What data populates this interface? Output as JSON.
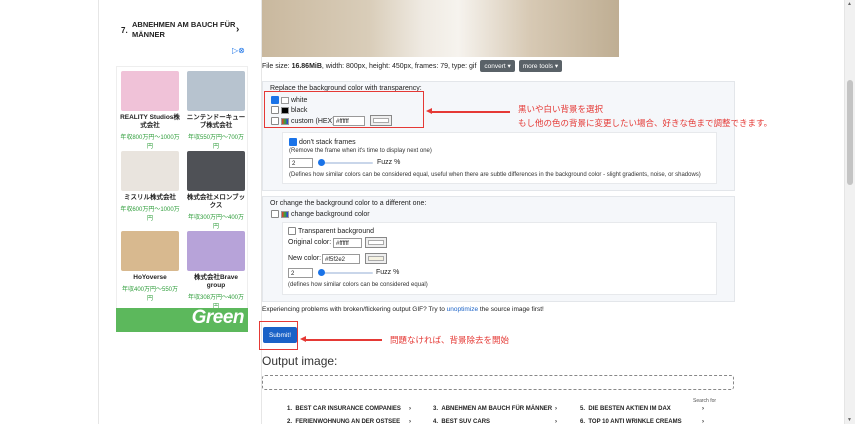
{
  "left_ad": {
    "top_item": {
      "num": "7.",
      "text": "ABNEHMEN AM BAUCH FÜR MÄNNER",
      "chevron": "›"
    },
    "ad_choices": "▷⊗",
    "jobs": [
      {
        "name": "REALITY Studios株式会社",
        "salary": "年収800万円〜1000万円",
        "img_color": "#f0c2d8"
      },
      {
        "name": "ニンテンドーキューブ株式会社",
        "salary": "年収550万円〜700万円",
        "img_color": "#b7c3cf"
      },
      {
        "name": "ミスリル株式会社",
        "salary": "年収600万円〜1000万円",
        "img_color": "#e9e4de"
      },
      {
        "name": "株式会社メロンブックス",
        "salary": "年収300万円〜400万円",
        "img_color": "#4f5156"
      },
      {
        "name": "HoYoverse",
        "salary": "年収400万円〜550万円",
        "img_color": "#d8b98f"
      },
      {
        "name": "株式会社Brave group",
        "salary": "年収308万円〜400万円",
        "img_color": "#b7a3d9"
      }
    ],
    "banner_text": "Green"
  },
  "file_info": {
    "prefix": "File size: ",
    "size": "16.86MiB",
    "rest": ", width: 800px, height: 450px, frames: 79, type: gif",
    "convert_label": "convert ▾",
    "more_tools_label": "more tools ▾"
  },
  "replace_panel": {
    "heading": "Replace the background color with transparency:",
    "white_label": "white",
    "black_label": "black",
    "custom_label": "custom (HEX):",
    "custom_value": "#ffffff",
    "dont_stack_label": "don't stack frames",
    "dont_stack_hint": "(Remove the frame when it's time to display next one)",
    "fuzz_value": "2",
    "fuzz_label": "Fuzz %",
    "fuzz_level_percent": 2,
    "fuzz_hint": "(Defines how similar colors can be considered equal, useful when there are subtle differences in the background color - slight gradients, noise, or shadows)"
  },
  "change_panel": {
    "heading": "Or change the background color to a different one:",
    "change_label": "change background color",
    "transparent_label": "Transparent background",
    "original_label": "Original color:",
    "original_value": "#ffffff",
    "new_label": "New color:",
    "new_value": "#f5f2e2",
    "fuzz_value": "2",
    "fuzz_label": "Fuzz %",
    "fuzz_level_percent": 2,
    "fuzz_hint": "(defines how similar colors can be considered equal)"
  },
  "problem_note": {
    "before": "Experiencing problems with broken/flickering output GIF? Try to ",
    "link": "unoptimize",
    "after": " the source image first!"
  },
  "submit_label": "Submit!",
  "output_title": "Output image:",
  "search_for": "Search for",
  "bottom_ads": [
    {
      "num": "1.",
      "text": "BEST CAR INSURANCE COMPANIES",
      "chevron": "›"
    },
    {
      "num": "3.",
      "text": "ABNEHMEN AM BAUCH FÜR MÄNNER",
      "chevron": "›"
    },
    {
      "num": "5.",
      "text": "DIE BESTEN AKTIEN IM DAX",
      "chevron": "›"
    },
    {
      "num": "2.",
      "text": "FERIENWOHNUNG AN DER OSTSEE",
      "chevron": "›"
    },
    {
      "num": "4.",
      "text": "BEST SUV CARS",
      "chevron": "›"
    },
    {
      "num": "6.",
      "text": "TOP 10 ANTI WRINKLE CREAMS",
      "chevron": "›"
    }
  ],
  "annotations": {
    "line1": "黒いや白い背景を選択",
    "line2": "もし他の色の背景に変更したい場合、好きな色まで調整できます。",
    "line3": "問題なければ、背景除去を開始"
  },
  "colors": {
    "accent": "#1a73e8",
    "annotation_red": "#e53935",
    "green": "#5cb85c"
  }
}
